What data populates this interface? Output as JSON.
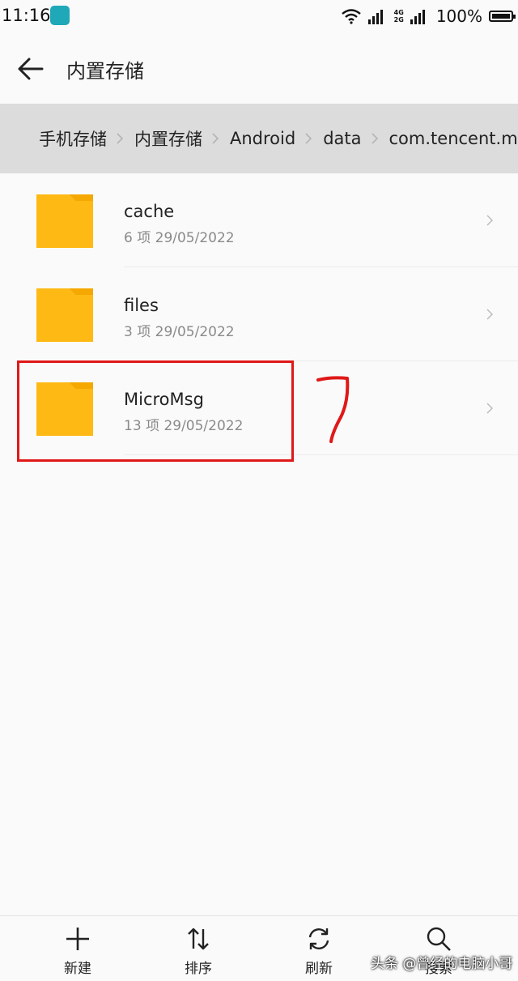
{
  "status_bar": {
    "time": "11:16",
    "network_top": "4G",
    "network_bottom": "2G",
    "battery": "100%"
  },
  "header": {
    "title": "内置存储"
  },
  "breadcrumb": [
    "手机存储",
    "内置存储",
    "Android",
    "data",
    "com.tencent.mm"
  ],
  "files": [
    {
      "name": "cache",
      "meta": "6 项  29/05/2022"
    },
    {
      "name": "files",
      "meta": "3 项  29/05/2022"
    },
    {
      "name": "MicroMsg",
      "meta": "13 项  29/05/2022"
    }
  ],
  "toolbar": {
    "new_label": "新建",
    "sort_label": "排序",
    "refresh_label": "刷新",
    "search_label": "搜索"
  },
  "watermark": "头条 @曾经的电脑小哥",
  "colors": {
    "folder": "#ffb915",
    "folder_tab": "#f5a800",
    "annotation": "#e01818",
    "breadcrumb_bg": "#dcdcdc"
  }
}
